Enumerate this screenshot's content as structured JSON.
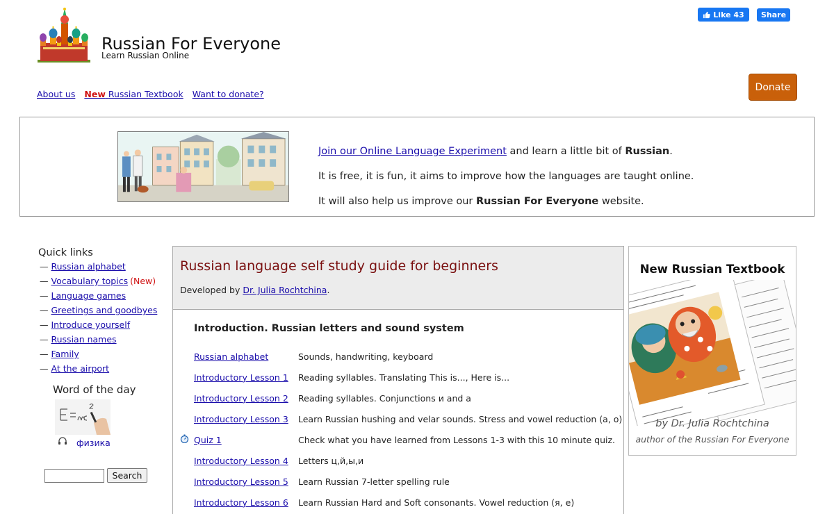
{
  "header": {
    "title": "Russian For Everyone",
    "subtitle": "Learn Russian Online",
    "fb_like_label": "Like 43",
    "fb_share_label": "Share",
    "donate_label": "Donate"
  },
  "nav": {
    "about": "About us",
    "new_word": "New",
    "textbook": "Russian Textbook",
    "donate_link": "Want to donate?"
  },
  "banner": {
    "link_text": "Join our Online Language Experiment",
    "line1_mid": " and learn a little bit of ",
    "line1_bold": "Russian",
    "line1_end": ".",
    "line2": "It is free, it is fun, it aims to improve how the languages are taught online.",
    "line3_start": "It will also help us improve our ",
    "line3_bold": "Russian For Everyone",
    "line3_end": " website."
  },
  "sidebar": {
    "quick_links_title": "Quick links",
    "links": [
      {
        "label": "Russian alphabet",
        "tag": ""
      },
      {
        "label": "Vocabulary topics",
        "tag": "(New)"
      },
      {
        "label": "Language games",
        "tag": ""
      },
      {
        "label": "Greetings and goodbyes",
        "tag": ""
      },
      {
        "label": "Introduce yourself",
        "tag": ""
      },
      {
        "label": "Russian names",
        "tag": ""
      },
      {
        "label": "Family",
        "tag": ""
      },
      {
        "label": "At the airport",
        "tag": ""
      }
    ],
    "word_of_day_title": "Word of the day",
    "word_of_day": "физика",
    "search_button": "Search"
  },
  "main": {
    "title": "Russian language self study guide for beginners",
    "developed_by": "Developed by ",
    "author_link": "Dr. Julia Rochtchina",
    "period": ".",
    "section_title": "Introduction. Russian letters and sound system",
    "lessons": [
      {
        "link": "Russian alphabet",
        "desc": "Sounds, handwriting, keyboard",
        "icon": ""
      },
      {
        "link": "Introductory Lesson 1",
        "desc": "Reading syllables. Translating This is..., Here is...",
        "icon": ""
      },
      {
        "link": "Introductory Lesson 2",
        "desc": "Reading syllables. Conjunctions и and а",
        "icon": ""
      },
      {
        "link": "Introductory Lesson 3",
        "desc": "Learn Russian hushing and velar sounds. Stress and vowel reduction (а, о)",
        "icon": ""
      },
      {
        "link": "Quiz 1",
        "desc": "Check what you have learned from Lessons 1-3 with this 10 minute quiz.",
        "icon": "stopwatch-icon"
      },
      {
        "link": "Introductory Lesson 4",
        "desc": "Letters ц,й,ы,и",
        "icon": ""
      },
      {
        "link": "Introductory Lesson 5",
        "desc": "Learn Russian 7-letter spelling rule",
        "icon": ""
      },
      {
        "link": "Introductory Lesson 6",
        "desc": "Learn Russian Hard and Soft consonants. Vowel reduction (я, е)",
        "icon": ""
      }
    ]
  },
  "textbook": {
    "title": "New Russian Textbook",
    "author": "by Dr. Julia Rochtchina",
    "subtitle": "author of the Russian For Everyone"
  },
  "colors": {
    "link": "#1a0dab",
    "accent_red": "#d01212",
    "title_red": "#7a1010",
    "donate": "#c9600a",
    "facebook": "#1877f2"
  }
}
